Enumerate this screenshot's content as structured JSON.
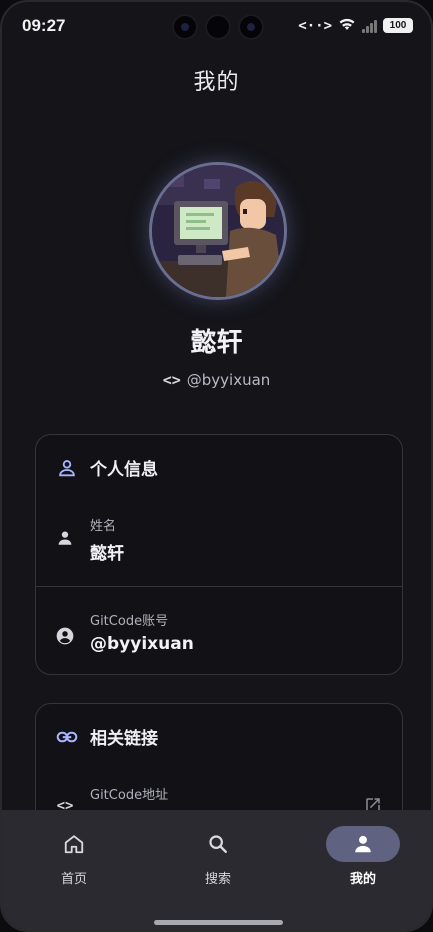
{
  "status_bar": {
    "time": "09:27",
    "nfc_glyph": "<··>",
    "battery": "100"
  },
  "header": {
    "title": "我的"
  },
  "profile": {
    "name": "懿轩",
    "handle_icon": "<>",
    "handle": "@byyixuan"
  },
  "personal_info": {
    "title": "个人信息",
    "rows": [
      {
        "label": "姓名",
        "value": "懿轩",
        "icon": "person-icon"
      },
      {
        "label": "GitCode账号",
        "value": "@byyixuan",
        "icon": "account-circle-icon"
      }
    ]
  },
  "links": {
    "title": "相关链接",
    "rows": [
      {
        "label": "GitCode地址",
        "icon": "code-icon",
        "action_icon": "open-in-new-icon"
      }
    ]
  },
  "bottom_nav": {
    "items": [
      {
        "label": "首页",
        "icon": "home-icon"
      },
      {
        "label": "搜索",
        "icon": "search-icon"
      },
      {
        "label": "我的",
        "icon": "person-icon",
        "active": true
      }
    ]
  },
  "colors": {
    "background": "#141419",
    "accent": "#a9b6ff",
    "active_pill": "#5f6280",
    "nav_bg": "#2a2a30"
  }
}
